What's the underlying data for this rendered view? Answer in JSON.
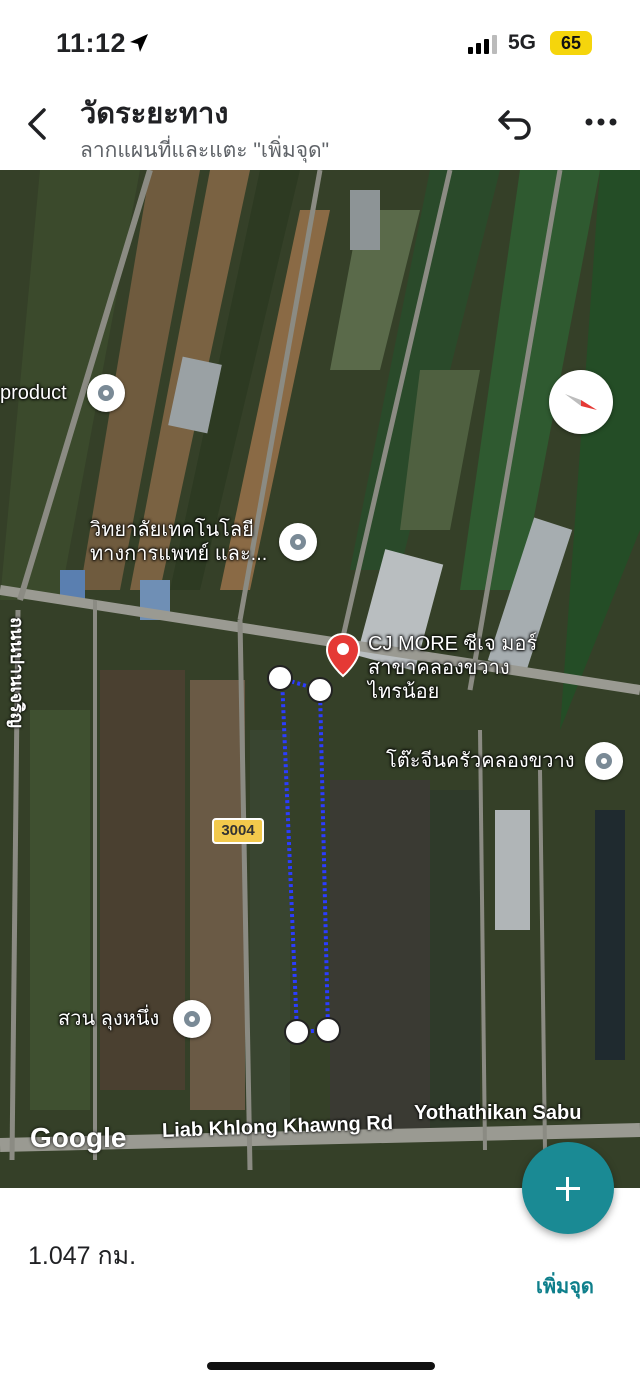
{
  "status_bar": {
    "time": "11:12",
    "network": "5G",
    "battery": "65"
  },
  "header": {
    "title": "วัดระยะทาง",
    "subtitle": "ลากแผนที่และแตะ \"เพิ่มจุด\""
  },
  "map": {
    "pois": [
      {
        "label": "product"
      },
      {
        "label": "วิทยาลัยเทคโนโลยี\nทางการแพทย์ และ..."
      },
      {
        "label": "CJ MORE ซีเจ มอร์\nสาขาคลองขวาง\nไทรน้อย"
      },
      {
        "label": "โต๊ะจีนครัวคลองขวาง"
      },
      {
        "label": "สวน ลุงหนึ่ง"
      }
    ],
    "road_shield": "3004",
    "road_labels": {
      "vertical": "ถนนปานเจริญ",
      "liab": "Liab Khlong Khawng Rd",
      "yotha": "Yothathikan Sabu"
    },
    "attribution": "Google"
  },
  "measurement": {
    "distance": "1.047 กม.",
    "add_point_label": "เพิ่มจุด"
  },
  "colors": {
    "accent": "#1a8a94",
    "path": "#2b3cff",
    "marker": "#e53935"
  },
  "icons": [
    "back-arrow-icon",
    "undo-icon",
    "more-icon",
    "compass-icon",
    "add-icon",
    "location-arrow-icon"
  ]
}
